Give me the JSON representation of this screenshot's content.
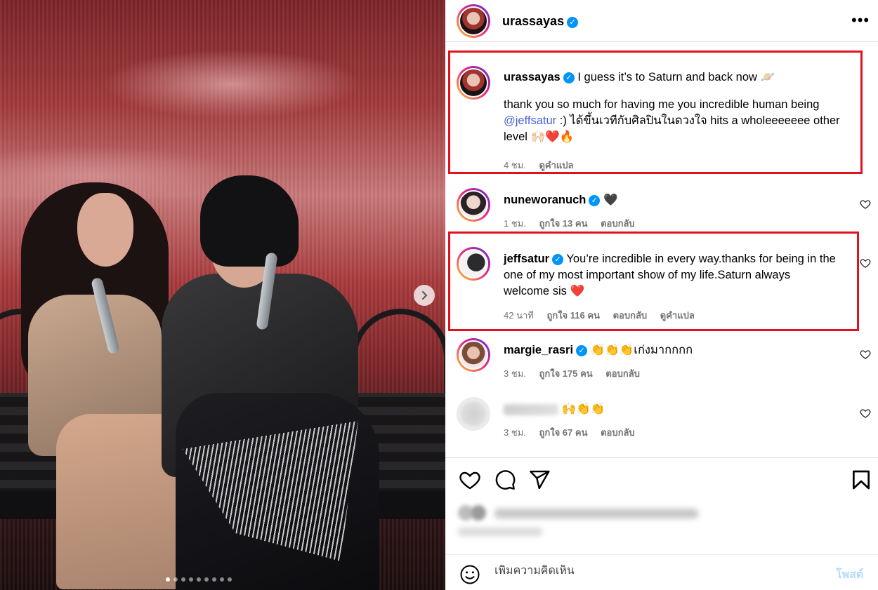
{
  "post": {
    "author": "urassayas",
    "carousel": {
      "slides": 9,
      "active_index": 0
    }
  },
  "comments": [
    {
      "username": "urassayas",
      "verified": true,
      "text_line1": "I guess it’s to Saturn and back now 🪐",
      "text_line2": "thank you so much for having me you incredible human being",
      "mention": "@jeffsatur",
      "text_line3a": " :) ",
      "text_thai": "ได้ขึ้นเวทีกับศิลปินในดวงใจ",
      "text_line3b": " hits a wholeeeeeee other",
      "text_line4": "level 🙌🏻❤️🔥",
      "time": "4 ชม.",
      "translate": "ดูคำแปล",
      "highlighted": true
    },
    {
      "username": "nuneworanuch",
      "verified": true,
      "text": "🖤",
      "time": "1 ชม.",
      "likes": "ถูกใจ 13 คน",
      "reply": "ตอบกลับ"
    },
    {
      "username": "jeffsatur",
      "verified": true,
      "text": "You’re incredible in every way.thanks for being in the one of my most important show of my life.Saturn always welcome sis ❤️",
      "time": "42 นาที",
      "likes": "ถูกใจ 116 คน",
      "reply": "ตอบกลับ",
      "translate": "ดูคำแปล",
      "highlighted": true
    },
    {
      "username": "margie_rasri",
      "verified": true,
      "text": "👏👏👏เก่งมากกกก",
      "time": "3 ชม.",
      "likes": "ถูกใจ 175 คน",
      "reply": "ตอบกลับ"
    },
    {
      "username": "",
      "text": "🙌👏👏",
      "time": "3 ชม.",
      "likes": "ถูกใจ 67 คน",
      "reply": "ตอบกลับ",
      "blurred": true
    }
  ],
  "composer": {
    "placeholder": "เพิ่มความคิดเห็น",
    "post_label": "โพสต์"
  },
  "icons": [
    "heart-icon",
    "comment-icon",
    "share-icon",
    "bookmark-icon",
    "emoji-icon",
    "more-icon",
    "verified-badge-icon",
    "chevron-right-icon"
  ],
  "colors": {
    "highlight": "#e0121d",
    "verified": "#0095f6",
    "mention": "#4a5fd8",
    "post_button": "#b3dbff"
  }
}
